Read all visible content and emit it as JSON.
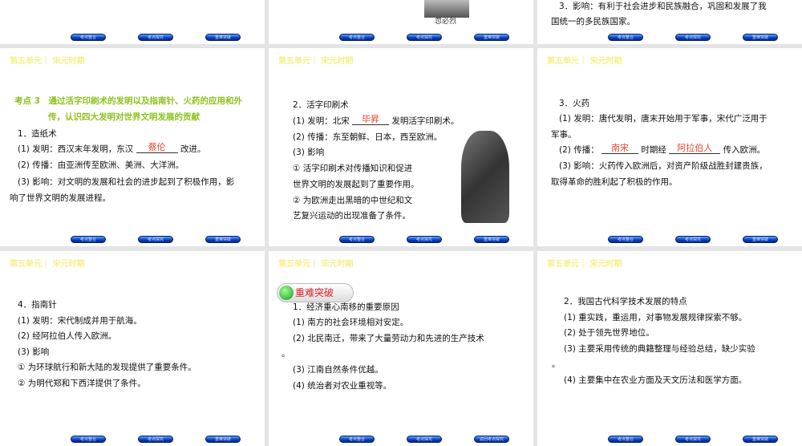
{
  "header": "第五单元｜ 宋元时期",
  "nav_buttons": [
    "考点整合",
    "考点探究",
    "重难突破"
  ],
  "last_nav_buttons": [
    "考点整合",
    "考点探究",
    "返回考点探究"
  ],
  "slide_top_mid": {
    "caption": "忽必烈"
  },
  "slide_top_right": {
    "lines": [
      "3．影响：有利于社会进步和民族融合，巩固和发展了我",
      "国统一的多民族国家。"
    ]
  },
  "slide_a": {
    "title1": "考点 3　通过活字印刷术的发明以及指南针、火药的应用和外",
    "title2": "传，认识四大发明对世界文明发展的贡献",
    "h": "1．造纸术",
    "l1a": "(1) 发明：西汉末年发明，东汉 ",
    "l1blank": "蔡伦",
    "l1b": " 改进。",
    "l2": "(2) 传播：由亚洲传至欧洲、美洲、大洋洲。",
    "l3": "(3) 影响：对文明的发展和社会的进步起到了积极作用，影",
    "l4": "响了世界文明的发展进程。"
  },
  "slide_b": {
    "h": "2．活字印刷术",
    "l1a": "(1) 发明：北宋 ",
    "l1blank": "毕昇",
    "l1b": " 发明活字印刷术。",
    "l2": "(2) 传播：东至朝鲜、日本，西至欧洲。",
    "l3": "(3) 影响",
    "l4": "① 活字印刷术对传播知识和促进",
    "l5": "世界文明的发展起到了重要作用。",
    "l6": "② 为欧洲走出黑暗的中世纪和文",
    "l7": "艺复兴运动的出现准备了条件。"
  },
  "slide_c": {
    "h": "3．火药",
    "l1": "(1) 发明：唐代发明，唐末开始用于军事，宋代广泛用于",
    "l2": "军事。",
    "l3a": "(2) 传播： ",
    "b1": "南宋",
    "l3b": " 时期经 ",
    "b2": "阿拉伯人",
    "l3c": " 传入欧洲。",
    "l4": "(3) 影响：火药传入欧洲后，对资产阶级战胜封建贵族，",
    "l5": "取得革命的胜利起了积极的作用。"
  },
  "slide_d": {
    "lines": [
      "4．指南针",
      "(1) 发明：宋代制成并用于航海。",
      "(2) 经阿拉伯人传入欧洲。",
      "(3) 影响",
      "① 为环球航行和新大陆的发现提供了重要条件。",
      "② 为明代郑和下西洋提供了条件。"
    ]
  },
  "slide_e": {
    "badge": "重难突破",
    "lines": [
      "1．经济重心南移的重要原因",
      "(1) 南方的社会环境相对安定。",
      "(2) 北民南迁，带来了大量劳动力和先进的生产技术"
    ],
    "dot": "。",
    "lines2": [
      "(3) 江南自然条件优越。",
      "(4) 统治者对农业重视等。"
    ]
  },
  "slide_f": {
    "lines": [
      "2．我国古代科学技术发展的特点",
      "(1) 重实践，重运用，对事物发展规律探索不够。",
      "(2) 处于领先世界地位。",
      "(3) 主要采用传统的典籍整理与经验总结，缺少实验"
    ],
    "dot": "。",
    "l5": "(4) 主要集中在农业方面及天文历法和医学方面。"
  }
}
